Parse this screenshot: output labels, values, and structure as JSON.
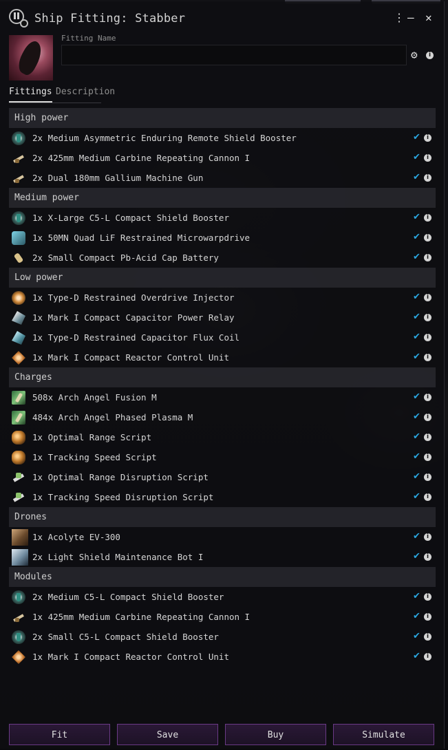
{
  "window": {
    "title": "Ship Fitting: Stabber",
    "controls": {
      "menu": "⋮",
      "minimize": "—",
      "close": "✕"
    }
  },
  "header": {
    "fitting_name_label": "Fitting Name",
    "fitting_name_value": "",
    "settings_icon": "gear-icon",
    "info_icon": "info-icon"
  },
  "tabs": [
    {
      "label": "Fittings",
      "active": true
    },
    {
      "label": "Description",
      "active": false
    }
  ],
  "colors": {
    "check": "#2aa6e0",
    "button_border": "#6a3a86"
  },
  "sections": [
    {
      "title": "High power",
      "items": [
        {
          "text": "2x Medium Asymmetric Enduring Remote Shield Booster",
          "icon": "shield"
        },
        {
          "text": "2x 425mm Medium Carbine Repeating Cannon I",
          "icon": "gun"
        },
        {
          "text": "2x Dual 180mm Gallium Machine Gun",
          "icon": "gun"
        }
      ]
    },
    {
      "title": "Medium power",
      "items": [
        {
          "text": "1x X-Large C5-L Compact Shield Booster",
          "icon": "shield"
        },
        {
          "text": "1x 50MN Quad LiF Restrained Microwarpdrive",
          "icon": "mwd"
        },
        {
          "text": "2x Small Compact Pb-Acid Cap Battery",
          "icon": "cap"
        }
      ]
    },
    {
      "title": "Low power",
      "items": [
        {
          "text": "1x Type-D Restrained Overdrive Injector",
          "icon": "od"
        },
        {
          "text": "1x Mark I Compact Capacitor Power Relay",
          "icon": "relay"
        },
        {
          "text": "1x Type-D Restrained Capacitor Flux Coil",
          "icon": "flux"
        },
        {
          "text": "1x Mark I Compact Reactor Control Unit",
          "icon": "rcu"
        }
      ]
    },
    {
      "title": "Charges",
      "items": [
        {
          "text": "508x Arch Angel Fusion M",
          "icon": "ammo"
        },
        {
          "text": "484x Arch Angel Phased Plasma M",
          "icon": "ammo"
        },
        {
          "text": "1x Optimal Range Script",
          "icon": "script"
        },
        {
          "text": "1x Tracking Speed Script",
          "icon": "script"
        },
        {
          "text": "1x Optimal Range Disruption Script",
          "icon": "disrupt"
        },
        {
          "text": "1x Tracking Speed Disruption Script",
          "icon": "disrupt"
        }
      ]
    },
    {
      "title": "Drones",
      "items": [
        {
          "text": "1x Acolyte EV-300",
          "icon": "drone"
        },
        {
          "text": "2x Light Shield Maintenance Bot I",
          "icon": "bot"
        }
      ]
    },
    {
      "title": "Modules",
      "items": [
        {
          "text": "2x Medium C5-L Compact Shield Booster",
          "icon": "shield"
        },
        {
          "text": "1x 425mm Medium Carbine Repeating Cannon I",
          "icon": "gun"
        },
        {
          "text": "2x Small C5-L Compact Shield Booster",
          "icon": "shield"
        },
        {
          "text": "1x Mark I Compact Reactor Control Unit",
          "icon": "rcu"
        }
      ]
    }
  ],
  "footer": {
    "buttons": [
      "Fit",
      "Save",
      "Buy",
      "Simulate"
    ]
  }
}
